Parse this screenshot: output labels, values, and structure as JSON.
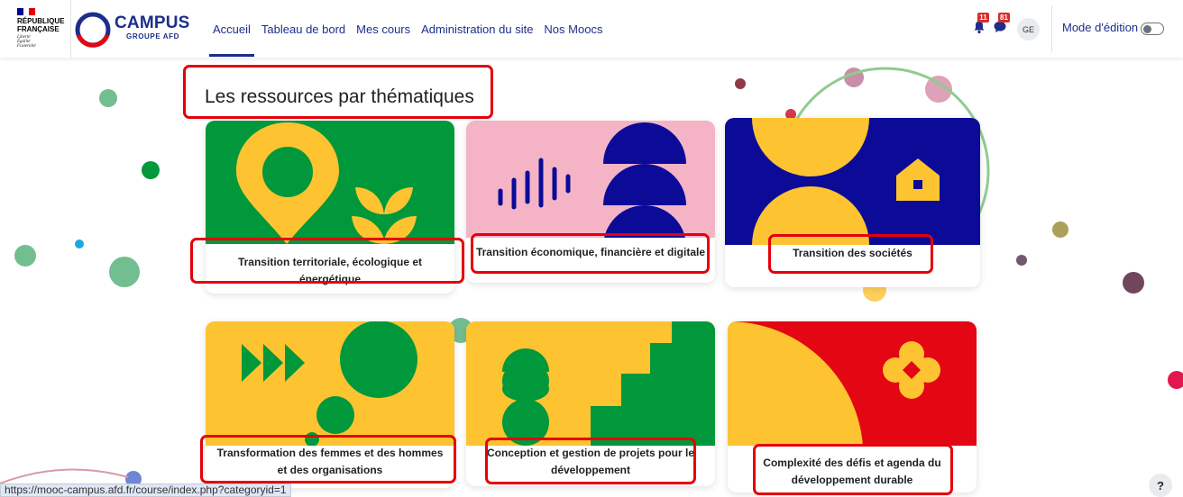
{
  "header": {
    "gov_name": "RÉPUBLIQUE\nFRANÇAISE",
    "gov_motto": "Liberté\nÉgalité\nFraternité",
    "logo_title": "CAMPUS",
    "logo_subtitle": "GROUPE AFD",
    "nav": [
      "Accueil",
      "Tableau de bord",
      "Mes cours",
      "Administration du site",
      "Nos Moocs"
    ],
    "active_nav": "Accueil",
    "notifications_count": "11",
    "messages_count": "81",
    "avatar_initials": "GE",
    "edit_mode_label": "Mode d'édition",
    "edit_mode_on": false
  },
  "page": {
    "title": "Les ressources par thématiques"
  },
  "categories": [
    {
      "label": "Transition territoriale, écologique et énergétique",
      "art": "green-pin-leaf",
      "highlighted": true
    },
    {
      "label": "Transition économique, financière et digitale",
      "art": "pink-waves-semicircles",
      "highlighted": true
    },
    {
      "label": "Transition des sociétés",
      "art": "blue-yellow-house",
      "highlighted": true
    },
    {
      "label": "Transformation des femmes et des hommes et des organisations",
      "art": "yellow-arrows-circles",
      "highlighted": true
    },
    {
      "label": "Conception et gestion de projets pour le développement",
      "art": "yellow-green-steps",
      "highlighted": true
    },
    {
      "label": "Complexité des défis et agenda du développement durable",
      "art": "red-yellow-flower",
      "highlighted": true
    }
  ],
  "status_bar_url": "https://mooc-campus.afd.fr/course/index.php?categoryid=1",
  "help_label": "?",
  "colors": {
    "brand_navy": "#1c2e8c",
    "green": "#00983a",
    "yellow": "#fec331",
    "pink": "#f4b4c6",
    "blue": "#0b0b98",
    "red": "#e30613",
    "annotation": "#e5000a"
  },
  "icons": [
    "bell-icon",
    "message-icon",
    "help-icon",
    "campus-ring-logo",
    "french-flag-icon"
  ]
}
